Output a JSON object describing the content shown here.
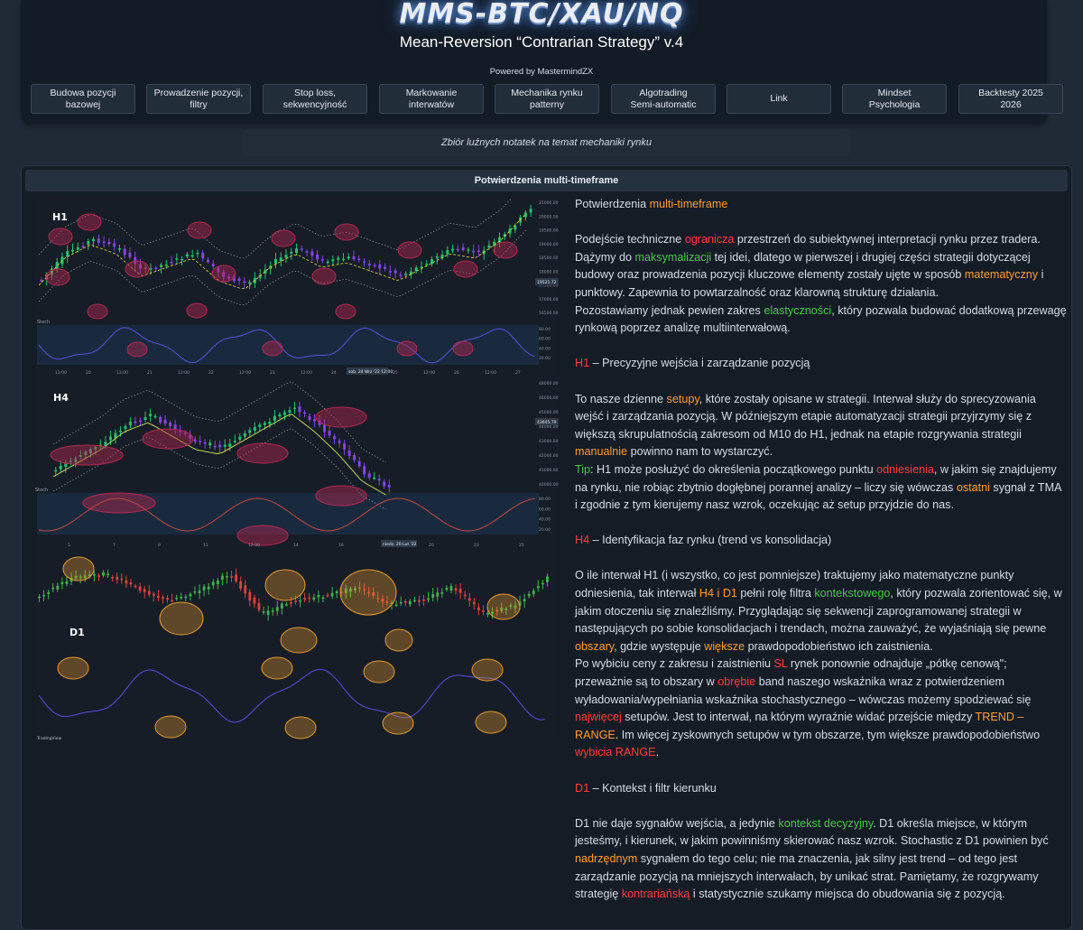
{
  "site": {
    "title": "MMS-BTC/XAU/NQ",
    "subtitle": "Mean-Reversion “Contrarian Strategy” v.4",
    "powered_by": "Powered by MastermindZX"
  },
  "nav": {
    "items": [
      {
        "label": "Budowa pozycji\nbazowej"
      },
      {
        "label": "Prowadzenie pozycji,\nfiltry"
      },
      {
        "label": "Stop loss,\nsekwencyjność"
      },
      {
        "label": "Markowanie\ninterwatów"
      },
      {
        "label": "Mechanika rynku\npatterny"
      },
      {
        "label": "Algotrading\nSemi-automatic"
      },
      {
        "label": "Link"
      },
      {
        "label": "Mindset\nPsychologia"
      },
      {
        "label": "Backtesty 2025\n2026"
      }
    ]
  },
  "tagline": "Zbiór luźnych notatek na temat mechaniki rynku",
  "section": {
    "title": "Potwierdzenia multi-timeframe"
  },
  "charts": {
    "h1": {
      "label": "H1",
      "x_ticks": [
        "13:00",
        "20",
        "13:00",
        "21",
        "12:00",
        "22",
        "12:00",
        "23",
        "12:00",
        "24",
        "12:00",
        "25",
        "12:00",
        "26",
        "12:00",
        "27"
      ],
      "y_ticks": [
        "21000.00",
        "20000.00",
        "19500.00",
        "19000.00",
        "18500.00",
        "18000.00",
        "17500.00",
        "17000.00",
        "16500.00"
      ],
      "osc_label": "Stoch",
      "osc_ticks": [
        "80.00",
        "60.00",
        "40.00",
        "20.00"
      ],
      "date_badge": "sob. 24 Wrz '22 12:00",
      "price_badge": "19521.72"
    },
    "h4": {
      "label": "H4",
      "x_ticks": [
        "5",
        "7",
        "9",
        "11",
        "12:00",
        "14",
        "16",
        "18",
        "20",
        "23",
        "25"
      ],
      "y_ticks": [
        "48000.00",
        "46000.00",
        "45000.00",
        "44000.00",
        "43000.00",
        "42000.00",
        "41000.00",
        "40000.00"
      ],
      "osc_label": "Stoch",
      "osc_ticks": [
        "80.00",
        "60.00",
        "40.00",
        "20.00"
      ],
      "date_badge": "niedz. 20 Lut '22",
      "price_badge": "43605.79"
    },
    "d1": {
      "label": "D1",
      "watermark": "TradingView"
    },
    "colors": {
      "bull": "#26c26a",
      "bear": "#8445e0",
      "d1_bull": "#3fb54c",
      "d1_bear": "#e0403c",
      "ellipse_pink": "#b3294f",
      "ellipse_orange": "#e69a2e",
      "osc_line": "#5b4fe0"
    }
  },
  "article": {
    "p1": [
      "Potwierdzenia ",
      "multi-timeframe"
    ],
    "p2": [
      "Podejście techniczne ",
      "ogranicza",
      " przestrzeń do subiektywnej interpretacji rynku przez tradera. Dążymy do ",
      "maksymalizacji",
      " tej idei, dlatego w pierwszej i drugiej części strategii dotyczącej budowy oraz prowadzenia pozycji kluczowe elementy zostały ujęte w sposób ",
      "matematyczny",
      " i punktowy. Zapewnia to powtarzalność oraz klarowną strukturę działania."
    ],
    "p3": [
      "Pozostawiamy jednak pewien zakres ",
      "elastyczności",
      ", który pozwala budować dodatkową przewagę rynkową poprzez analizę multiinterwałową."
    ],
    "p4": [
      "H1",
      " – Precyzyjne wejścia i zarządzanie pozycją"
    ],
    "p5": [
      "To nasze dzienne ",
      "setupy",
      ", które zostały opisane w strategii. Interwał służy do sprecyzowania wejść i zarządzania pozycją. W późniejszym etapie automatyzacji strategii przyjrzymy się z większą skrupulatnością zakresom od M10 do H1, jednak na etapie rozgrywania strategii ",
      "manualnie",
      " powinno nam to wystarczyć."
    ],
    "p6": [
      "Tip",
      ": H1 może posłużyć do określenia początkowego punktu ",
      "odniesienia",
      ", w jakim się znajdujemy na rynku, nie robiąc zbytnio dogłębnej porannej analizy – liczy się wówczas ",
      "ostatni",
      " sygnał z TMA i zgodnie z tym kierujemy nasz wzrok, oczekując aż setup przyjdzie do nas."
    ],
    "p7": [
      "H4",
      " – Identyfikacja faz rynku (trend vs konsolidacja)"
    ],
    "p8": [
      "O ile interwał H1 (i wszystko, co jest pomniejsze) traktujemy jako matematyczne punkty odniesienia, tak interwał ",
      "H4 i D1",
      " pełni rolę filtra ",
      "kontekstowego",
      ", który pozwala zorientować się, w jakim otoczeniu się znaleźliśmy. Przyglądając się sekwencji zaprogramowanej strategii w następujących po sobie konsolidacjach i trendach, można zauważyć, że wyjaśniają się pewne ",
      "obszary",
      ", gdzie występuje ",
      "większe",
      " prawdopodobieństwo ich zaistnienia."
    ],
    "p9": [
      "Po wybiciu ceny z zakresu i zaistnieniu ",
      "SL",
      " rynek ponownie odnajduje „pótkę cenową\"; przeważnie są to obszary w ",
      "obrębie",
      " band naszego wskaźnika wraz z potwierdzeniem wyładowania/wypełniania wskaźnika stochastycznego – wówczas możemy spodziewać się ",
      "najwięcej",
      " setupów. Jest to interwał, na którym wyraźnie widać przejście między ",
      "TREND – RANGE",
      ". Im więcej zyskownych setupów w tym obszarze, tym większe prawdopodobieństwo ",
      "wybicia RANGE",
      "."
    ],
    "p10": [
      "D1",
      " – Kontekst i filtr kierunku"
    ],
    "p11": [
      "D1 nie daje sygnałów wejścia, a jedynie ",
      "kontekst decyzyjny",
      ". D1 określa miejsce, w którym jesteśmy, i kierunek, w jakim powinniśmy skierować nasz wzrok. Stochastic z D1 powinien być ",
      "nadrzędnym",
      " sygnałem do tego celu; nie ma znaczenia, jak silny jest trend – od tego jest zarządzanie pozycją na mniejszych interwałach, by unikać strat. Pamiętamy, że rozgrywamy strategię ",
      "kontrariańską",
      " i statystycznie szukamy miejsca do obudowania się z pozycją."
    ]
  }
}
